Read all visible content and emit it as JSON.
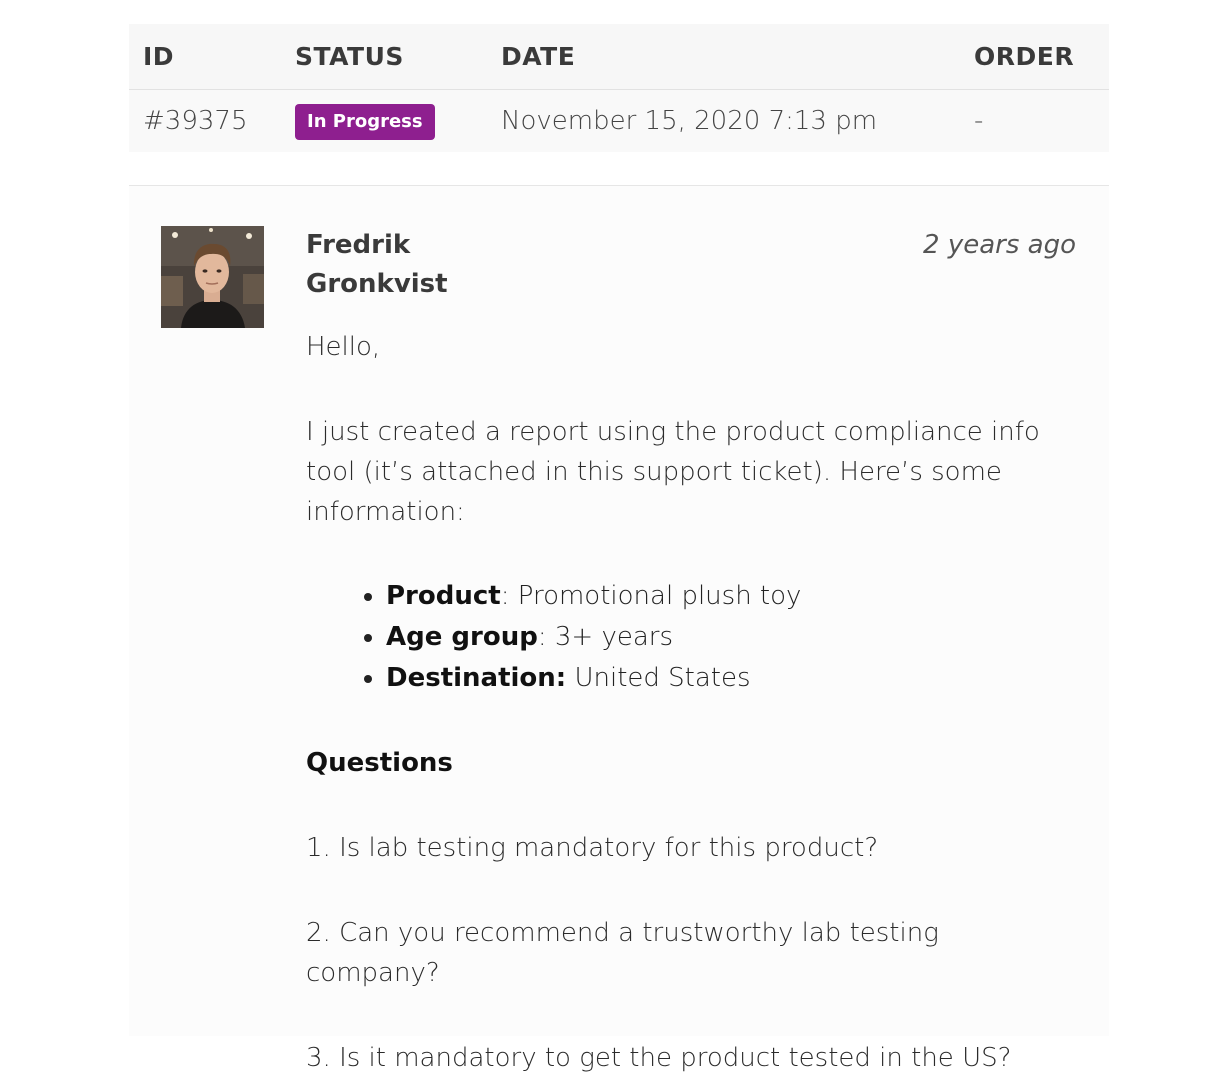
{
  "table": {
    "headers": {
      "id": "ID",
      "status": "STATUS",
      "date": "DATE",
      "order": "ORDER"
    },
    "row": {
      "id": "#39375",
      "status": "In Progress",
      "date": "November 15, 2020 7:13 pm",
      "order": "-"
    },
    "status_color": "#8e1f8f"
  },
  "message": {
    "author_first": "Fredrik",
    "author_last": "Gronkvist",
    "time_ago": "2 years ago",
    "greeting": "Hello,",
    "intro": "I just created a report using the product compliance info tool (it’s attached in this support ticket). Here’s some information:",
    "info_items": [
      {
        "label": "Product",
        "suffix": ":",
        "value": " Promotional plush toy"
      },
      {
        "label": "Age group",
        "suffix": ":",
        "value": " 3+ years"
      },
      {
        "label": "Destination:",
        "suffix": "",
        "value": " United States"
      }
    ],
    "questions_title": "Questions",
    "questions": [
      "1. Is lab testing mandatory for this product?",
      "2. Can you recommend a trustworthy lab testing company?",
      "3. Is it mandatory to get the product tested in the US?"
    ]
  }
}
